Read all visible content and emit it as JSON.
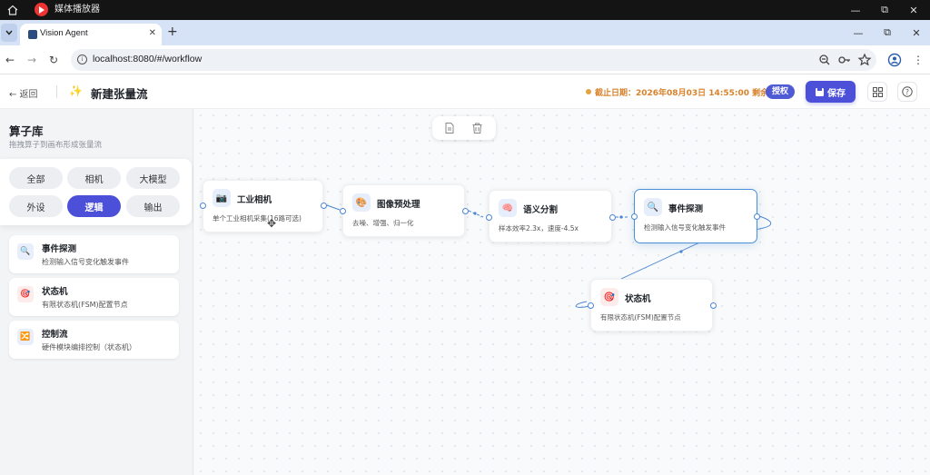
{
  "os": {
    "app_title": "媒体播放器",
    "controls": [
      "—",
      "⧉",
      "✕"
    ]
  },
  "browser": {
    "tab_title": "Vision Agent",
    "url": "localhost:8080/#/workflow",
    "window_controls": [
      "—",
      "⧉",
      "✕"
    ]
  },
  "header": {
    "back_label": "← 返回",
    "title": "新建张量流",
    "deadline": "截止日期：2026年08月03日 14:55:00 剩余1天",
    "auth_label": "授权",
    "save_label": "保存"
  },
  "sidebar": {
    "title": "算子库",
    "subtitle": "拖拽算子到画布形成张量流",
    "categories": [
      {
        "label": "全部",
        "active": false
      },
      {
        "label": "相机",
        "active": false
      },
      {
        "label": "大模型",
        "active": false
      },
      {
        "label": "外设",
        "active": false
      },
      {
        "label": "逻辑",
        "active": true
      },
      {
        "label": "输出",
        "active": false
      }
    ],
    "operators": [
      {
        "name": "事件探测",
        "desc": "检测输入信号变化触发事件",
        "icon": "🔍"
      },
      {
        "name": "状态机",
        "desc": "有限状态机(FSM)配置节点",
        "icon": "🎯"
      },
      {
        "name": "控制流",
        "desc": "硬件模块编排控制（状态机）",
        "icon": "🔀"
      }
    ]
  },
  "canvas": {
    "nodes": [
      {
        "id": "camera",
        "title": "工业相机",
        "desc": "单个工业相机采集(16路可选)",
        "icon": "📷",
        "selected": false
      },
      {
        "id": "preprocess",
        "title": "图像预处理",
        "desc": "去噪、增强、归一化",
        "icon": "🎨",
        "selected": false
      },
      {
        "id": "segment",
        "title": "语义分割",
        "desc": "样本效率2.3x，速度-4.5x",
        "icon": "🧠",
        "selected": false
      },
      {
        "id": "event",
        "title": "事件探测",
        "desc": "检测输入信号变化触发事件",
        "icon": "🔍",
        "selected": true
      },
      {
        "id": "fsm",
        "title": "状态机",
        "desc": "有限状态机(FSM)配置节点",
        "icon": "🎯",
        "selected": false
      }
    ]
  },
  "colors": {
    "accent": "#4c4fd8",
    "edge": "#4a86d4",
    "deadline": "#d9822b"
  }
}
